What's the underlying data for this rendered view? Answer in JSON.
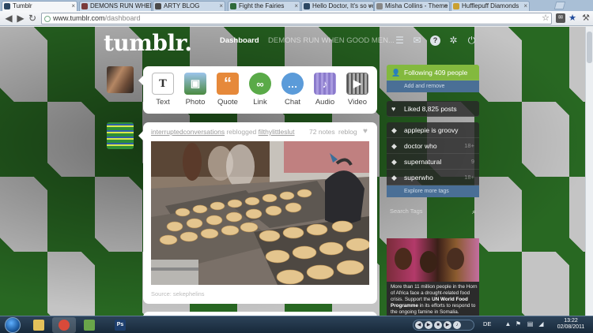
{
  "browser": {
    "tabs": [
      {
        "label": "Tumblr",
        "favicon_color": "#2c4762",
        "active": true
      },
      {
        "label": "DEMONS RUN WHEN",
        "favicon_color": "#7a3a3a",
        "active": false
      },
      {
        "label": "ARTY BLOG",
        "favicon_color": "#4a4a4a",
        "active": false
      },
      {
        "label": "Fight the Fairies",
        "favicon_color": "#2f6a3a",
        "active": false
      },
      {
        "label": "Hello Doctor, It's so ve",
        "favicon_color": "#2c4762",
        "active": false
      },
      {
        "label": "Misha Collins - Theme",
        "favicon_color": "#888888",
        "active": false
      },
      {
        "label": "Hufflepuff Diamonds",
        "favicon_color": "#caa030",
        "active": false
      }
    ],
    "url_domain": "www.tumblr.com",
    "url_path": "/dashboard",
    "back_icon": "back-arrow-icon",
    "forward_icon": "forward-arrow-icon",
    "reload_icon": "reload-icon",
    "star_icon": "star-icon",
    "wrench_icon": "wrench-icon"
  },
  "header": {
    "logo": "tumblr.",
    "nav_current": "Dashboard",
    "nav_other": "DEMONS RUN WHEN GOOD MEN...",
    "icons": [
      "list-icon",
      "mail-icon",
      "help-icon",
      "gear-icon",
      "power-icon"
    ]
  },
  "post_types": [
    {
      "label": "Text",
      "glyph": "T",
      "color": "#e8e8e8",
      "glyph_color": "#333333"
    },
    {
      "label": "Photo",
      "glyph": "▣",
      "color": "#6a9bd0",
      "glyph_color": "#ffffff"
    },
    {
      "label": "Quote",
      "glyph": "“",
      "color": "#e6893a",
      "glyph_color": "#ffffff"
    },
    {
      "label": "Link",
      "glyph": "∞",
      "color": "#5aaa48",
      "glyph_color": "#ffffff"
    },
    {
      "label": "Chat",
      "glyph": "…",
      "color": "#5b9bd9",
      "glyph_color": "#ffffff"
    },
    {
      "label": "Audio",
      "glyph": "♪",
      "color": "#8b7bcc",
      "glyph_color": "#ffffff"
    },
    {
      "label": "Video",
      "glyph": "▶",
      "color": "#888888",
      "glyph_color": "#ffffff"
    }
  ],
  "post": {
    "user": "interruptedconversations",
    "action": "reblogged",
    "source_user": "filthylittleslut",
    "notes": "72 notes",
    "reblog_label": "reblog",
    "caption_source": "Source: sekephelins"
  },
  "sidebar": {
    "following": "Following 409 people",
    "add_remove": "Add and remove",
    "liked": "Liked 8,825 posts",
    "tags": [
      {
        "label": "applepie is groovy",
        "count": ""
      },
      {
        "label": "doctor who",
        "count": "18+"
      },
      {
        "label": "supernatural",
        "count": "9"
      },
      {
        "label": "superwho",
        "count": "18+"
      }
    ],
    "explore": "Explore more tags",
    "search_placeholder": "Search Tags"
  },
  "ad": {
    "text_pre": "More than 11 million people in the Horn of Africa face a drought-related food crisis. Support the ",
    "text_bold": "UN World Food Programme",
    "text_post": " in its efforts to respond to the ongoing famine in Somalia."
  },
  "taskbar": {
    "apps": [
      {
        "name": "explorer",
        "color": "#e4c15a",
        "glyph": ""
      },
      {
        "name": "chrome",
        "color": "#d94a3a",
        "glyph": ""
      },
      {
        "name": "network",
        "color": "#6aa64a",
        "glyph": ""
      },
      {
        "name": "photoshop",
        "color": "#1e3f6e",
        "glyph": "Ps"
      }
    ],
    "language": "DE",
    "time": "13:22",
    "date": "02/08/2011"
  },
  "colors": {
    "tumblr_navy": "#2c4762",
    "argyle_green": "#2f7a28",
    "follow_green": "#83b93e",
    "sidebar_blue": "#4a6f96"
  }
}
